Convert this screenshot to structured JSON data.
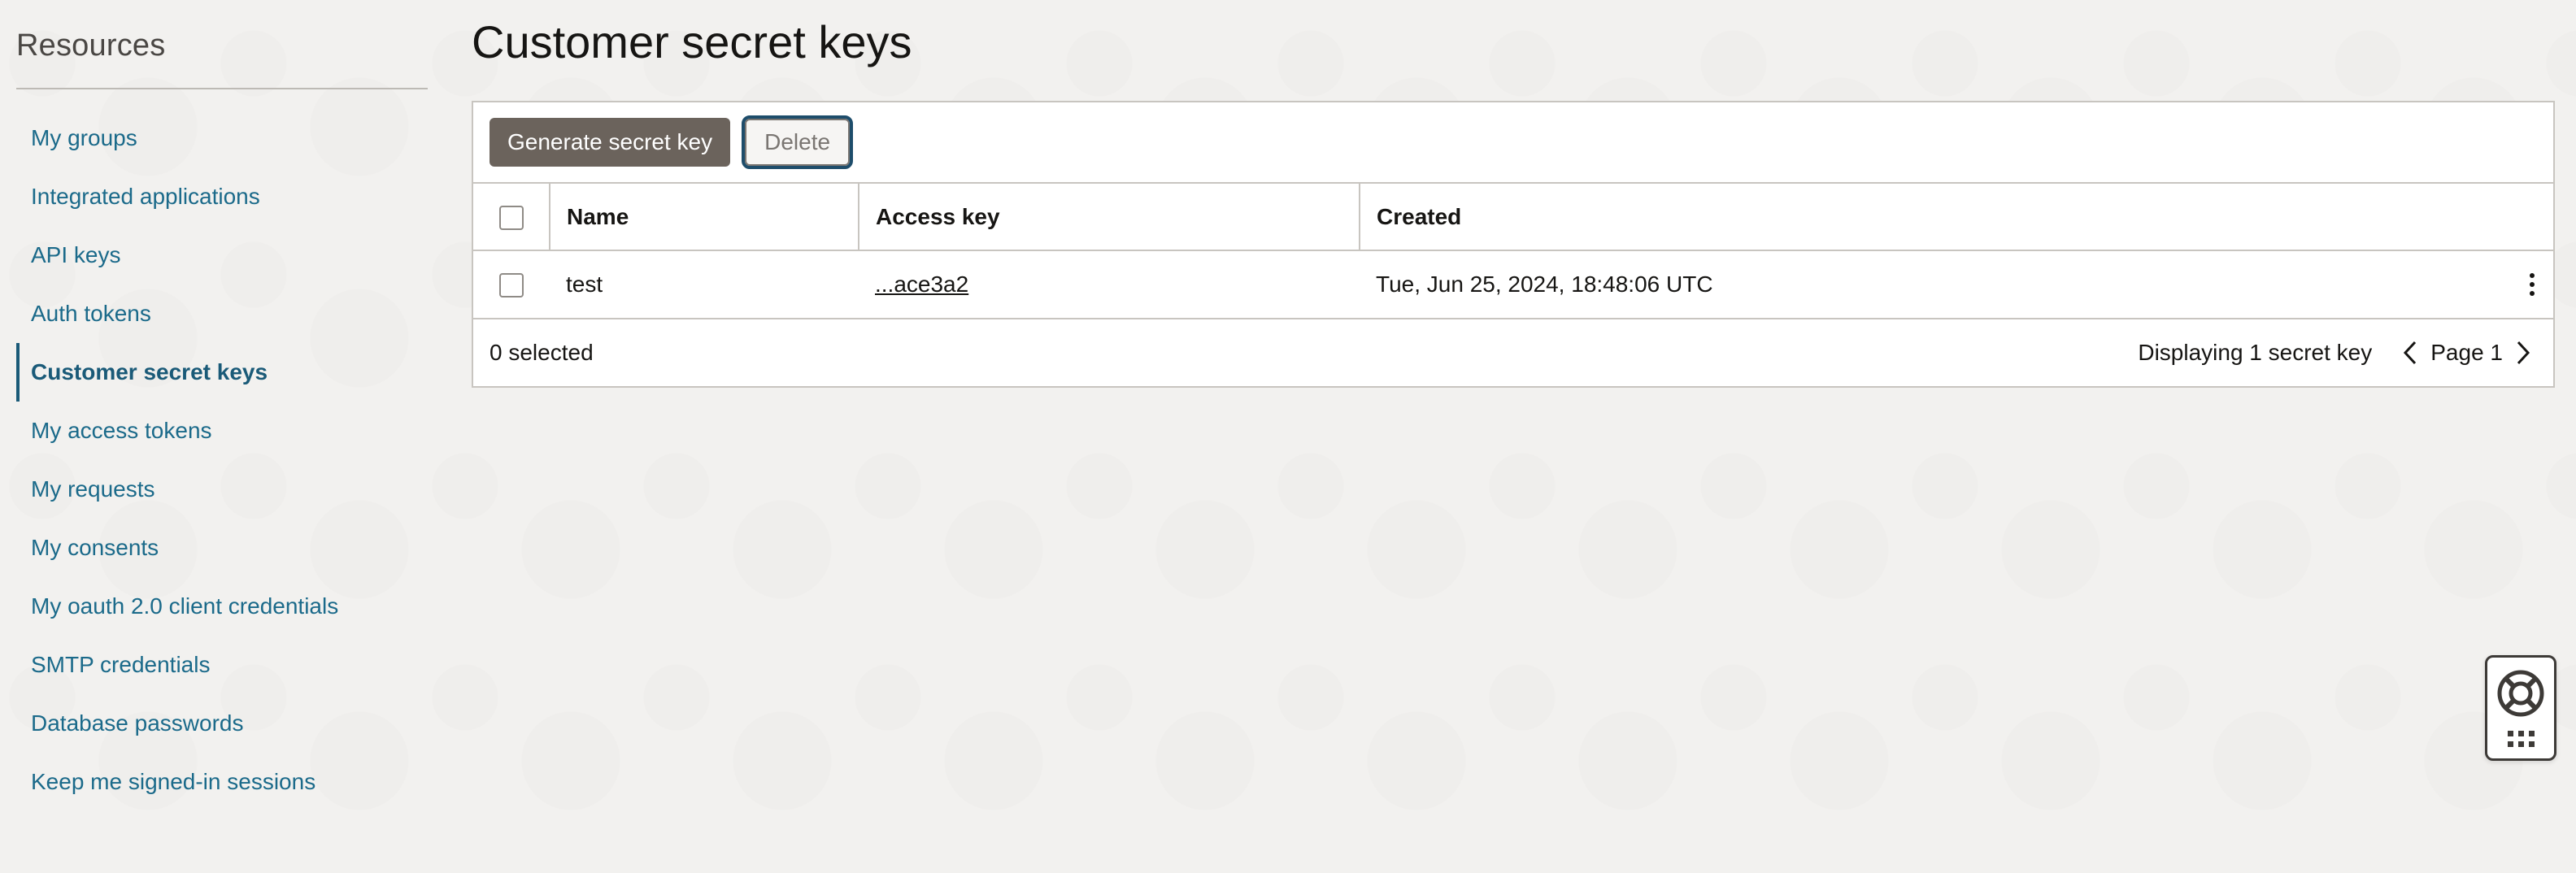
{
  "sidebar": {
    "title": "Resources",
    "items": [
      {
        "label": "My groups"
      },
      {
        "label": "Integrated applications"
      },
      {
        "label": "API keys"
      },
      {
        "label": "Auth tokens"
      },
      {
        "label": "Customer secret keys",
        "active": true
      },
      {
        "label": "My access tokens"
      },
      {
        "label": "My requests"
      },
      {
        "label": "My consents"
      },
      {
        "label": "My oauth 2.0 client credentials"
      },
      {
        "label": "SMTP credentials"
      },
      {
        "label": "Database passwords"
      },
      {
        "label": "Keep me signed-in sessions"
      }
    ]
  },
  "main": {
    "title": "Customer secret keys"
  },
  "toolbar": {
    "generate_label": "Generate secret key",
    "delete_label": "Delete"
  },
  "table": {
    "columns": [
      "Name",
      "Access key",
      "Created"
    ],
    "rows": [
      {
        "name": "test",
        "access_key": "...ace3a2",
        "created": "Tue, Jun 25, 2024, 18:48:06 UTC"
      }
    ]
  },
  "footer": {
    "selected": "0 selected",
    "displaying": "Displaying 1 secret key",
    "page": "Page 1"
  },
  "icons": {
    "prev": "chevron-left-icon",
    "next": "chevron-right-icon",
    "kebab": "more-vertical-icon",
    "help": "lifebuoy-icon",
    "apps": "grid-icon"
  },
  "colors": {
    "link": "#1b6a8a",
    "primary_button": "#6b635c",
    "focus_ring": "#1e4d6b"
  }
}
